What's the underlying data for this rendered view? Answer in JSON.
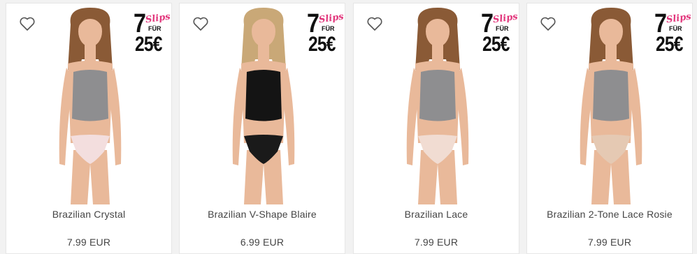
{
  "promo": {
    "number": "7",
    "word": "Slips",
    "fuer": "FÜR",
    "price": "25€"
  },
  "products": [
    {
      "name": "Brazilian Crystal",
      "price": "7.99 EUR",
      "top_color": "#8e8e90",
      "bottom_color": "#f3dede",
      "hair_color": "#8a5a36"
    },
    {
      "name": "Brazilian V-Shape Blaire",
      "price": "6.99 EUR",
      "top_color": "#141414",
      "bottom_color": "#1a1a1a",
      "hair_color": "#c9a877"
    },
    {
      "name": "Brazilian Lace",
      "price": "7.99 EUR",
      "top_color": "#8e8e90",
      "bottom_color": "#f1dcd2",
      "hair_color": "#8a5a36"
    },
    {
      "name": "Brazilian 2-Tone Lace Rosie",
      "price": "7.99 EUR",
      "top_color": "#8e8e90",
      "bottom_color": "#e5c9b3",
      "hair_color": "#8a5a36"
    }
  ],
  "colors": {
    "skin": "#e9b99a",
    "promo_accent": "#e2377c",
    "text": "#444444"
  }
}
